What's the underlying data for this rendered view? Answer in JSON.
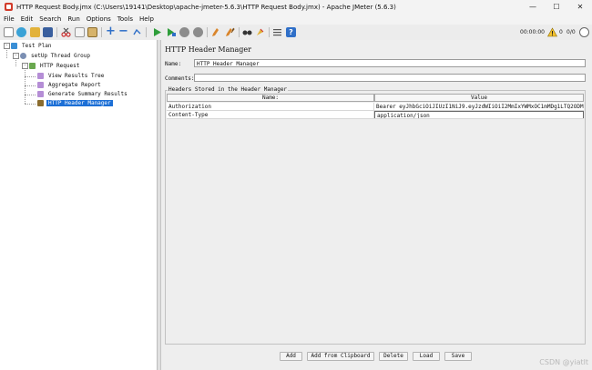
{
  "window": {
    "title": "HTTP Request Body.jmx (C:\\Users\\19141\\Desktop\\apache-jmeter-5.6.3\\HTTP Request Body.jmx) - Apache JMeter (5.6.3)",
    "minimize": "—",
    "maximize": "☐",
    "close": "✕"
  },
  "menu": [
    "File",
    "Edit",
    "Search",
    "Run",
    "Options",
    "Tools",
    "Help"
  ],
  "toolbar": {
    "timer": "00:00:00",
    "warning_count": "0",
    "threads": "0/0",
    "colors": {
      "green": "#2e9d3a",
      "blue": "#2f6fc8",
      "gray": "#8c8c8c",
      "orange": "#d9852b",
      "red": "#cc3333"
    }
  },
  "tree": {
    "test_plan": "Test Plan",
    "thread_group": "setUp Thread Group",
    "http_request": "HTTP Request",
    "view_results_tree": "View Results Tree",
    "aggregate_report": "Aggregate Report",
    "generate_summary": "Generate Summary Results",
    "header_manager": "HTTP Header Manager"
  },
  "panel": {
    "heading": "HTTP Header Manager",
    "name_label": "Name:",
    "name_value": "HTTP Header Manager",
    "comments_label": "Comments:",
    "comments_value": "",
    "group_title": "Headers Stored in the Header Manager",
    "columns": [
      "Name:",
      "Value"
    ],
    "rows": [
      {
        "name": "Authorization",
        "value": "Bearer eyJhbGciOiJIUzI1NiJ9.eyJzdWIiOiI2MmIxYWMxOC1mMDg1LTQ2ODMtODd..."
      },
      {
        "name": "Content-Type",
        "value": "application/json"
      }
    ],
    "buttons": [
      "Add",
      "Add from Clipboard",
      "Delete",
      "Load",
      "Save"
    ]
  },
  "watermark": "CSDN @yiatlt"
}
